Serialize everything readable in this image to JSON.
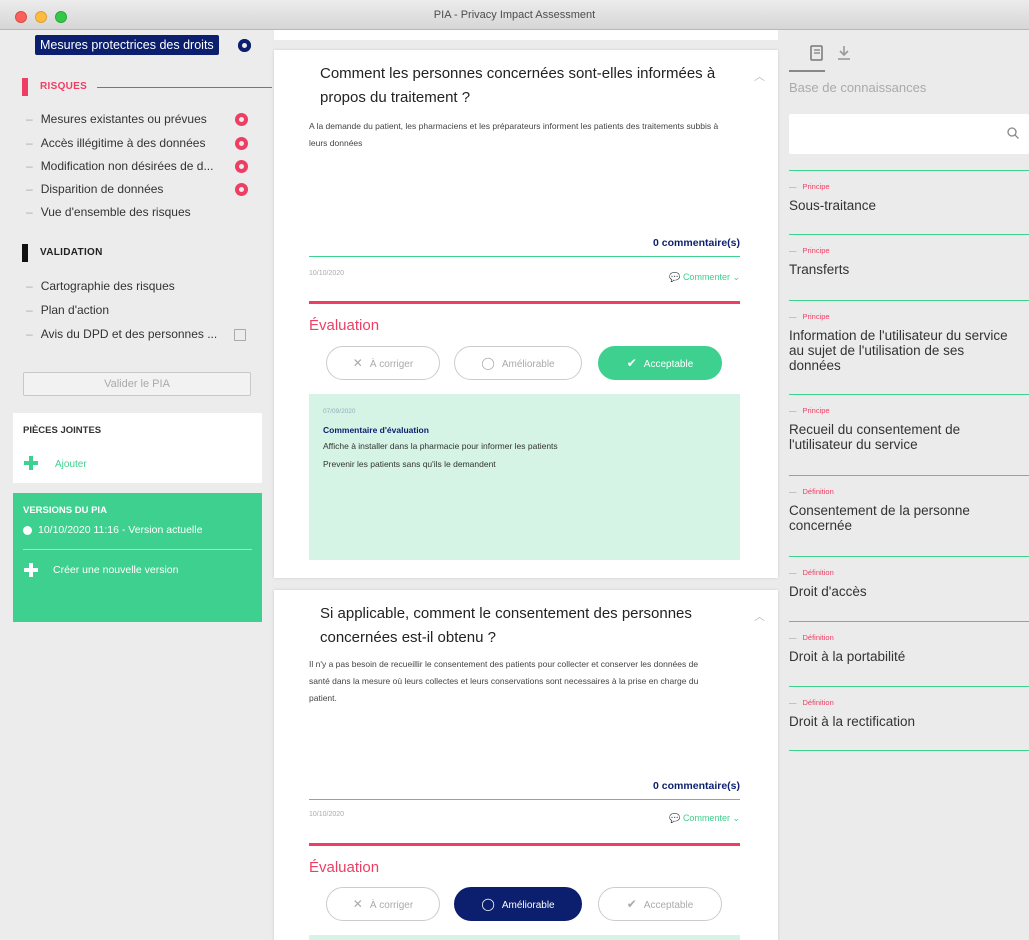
{
  "window": {
    "title": "PIA - Privacy Impact Assessment"
  },
  "sidebar": {
    "active_item": "Mesures protectrices des droits",
    "risks_title": "RISQUES",
    "risk_items": [
      "Mesures existantes ou prévues",
      "Accès illégitime à des données",
      "Modification non désirées de d...",
      "Disparition de données",
      "Vue d'ensemble des risques"
    ],
    "validation_title": "VALIDATION",
    "validation_items": [
      "Cartographie des risques",
      "Plan d'action",
      "Avis du DPD et des personnes ..."
    ],
    "validate_button": "Valider le PIA",
    "attachments_title": "PIÈCES JOINTES",
    "attachments_add": "Ajouter",
    "versions_title": "VERSIONS DU PIA",
    "version_current": "10/10/2020 11:16 - Version actuelle",
    "version_create": "Créer une nouvelle version"
  },
  "questions": [
    {
      "title": "Comment les personnes concernées sont-elles informées à propos du traitement ?",
      "answer": "A la demande du patient, les pharmaciens et les préparateurs informent les patients des traitements subbis à leurs données",
      "comments_count": "0 commentaire(s)",
      "date": "10/10/2020",
      "comment_link": "Commenter",
      "evaluation_title": "Évaluation",
      "buttons": [
        "À corriger",
        "Améliorable",
        "Acceptable"
      ],
      "eval_date": "07/09/2020",
      "eval_label": "Commentaire d'évaluation",
      "eval_lines": [
        "Affiche à installer dans la pharmacie pour informer les patients",
        "Prevenir les patients sans qu'ils le demandent"
      ]
    },
    {
      "title": "Si applicable, comment le consentement des personnes concernées est-il obtenu ?",
      "answer": "Il n'y a pas besoin de recueillir le consentement des patients pour collecter et conserver les données de santé dans la mesure où leurs collectes et leurs conservations sont necessaires à la prise en charge du patient.",
      "comments_count": "0 commentaire(s)",
      "date": "10/10/2020",
      "comment_link": "Commenter",
      "evaluation_title": "Évaluation",
      "buttons": [
        "À corriger",
        "Améliorable",
        "Acceptable"
      ]
    }
  ],
  "knowledge_base": {
    "title": "Base de connaissances",
    "search_placeholder": "",
    "items": [
      {
        "tag": "Principe",
        "name": "Sous-traitance"
      },
      {
        "tag": "Principe",
        "name": "Transferts"
      },
      {
        "tag": "Principe",
        "name": "Information de l'utilisateur du service au sujet de l'utilisation de ses données"
      },
      {
        "tag": "Principe",
        "name": "Recueil du consentement de l'utilisateur du service"
      },
      {
        "tag": "Définition",
        "name": "Consentement de la personne concernée"
      },
      {
        "tag": "Définition",
        "name": "Droit d'accès"
      },
      {
        "tag": "Définition",
        "name": "Droit à la portabilité"
      },
      {
        "tag": "Définition",
        "name": "Droit à la rectification"
      }
    ]
  },
  "colors": {
    "navy": "#0b1f6e",
    "pink": "#ee3e63",
    "green": "#3ed08e",
    "green_light": "#d5f4e5"
  },
  "icons": {
    "gear": "gear-icon",
    "edit": "edit-icon",
    "plus": "plus-icon",
    "search": "search-icon",
    "book": "book-icon",
    "download": "download-icon",
    "comment": "comment-icon",
    "close": "close-icon",
    "circle": "circle-icon",
    "check": "check-icon"
  }
}
